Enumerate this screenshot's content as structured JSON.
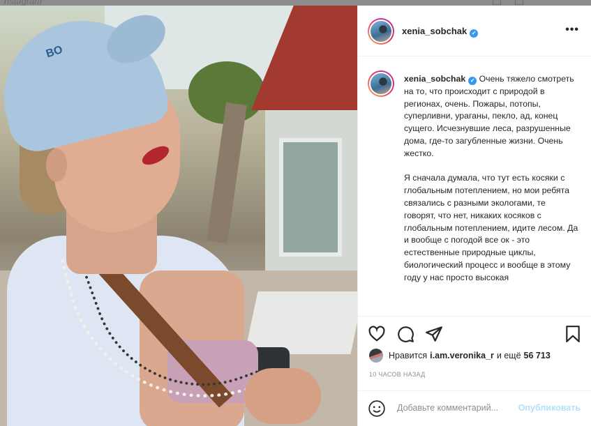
{
  "topbar": {
    "wordmark": "nstagram"
  },
  "photo": {
    "cap_text": "BO"
  },
  "post": {
    "username": "xenia_sobchak",
    "verified_mark": "✓",
    "more_label": "•••",
    "caption": {
      "username": "xenia_sobchak",
      "paragraphs": [
        "Очень тяжело смотреть на то, что происходит с природой в регионах, очень. Пожары, потопы, суперливни, ураганы, пекло, ад, конец сущего. Исчезнувшие леса, разрушенные дома, где-то загубленные жизни. Очень жестко.",
        "Я сначала думала, что тут есть косяки с глобальным потеплением, но мои ребята связались с разными экологами, те говорят, что нет, никаких косяков с глобальным потеплением, идите лесом. Да и вообще с погодой все ок - это естественные природные циклы, биологический процесс и вообще в этому году у нас просто высокая"
      ]
    },
    "likes": {
      "prefix": "Нравится",
      "user": "i.am.veronika_r",
      "middle": "и ещё",
      "count": "56 713"
    },
    "timestamp": "10 ЧАСОВ НАЗАД",
    "comment": {
      "placeholder": "Добавьте комментарий...",
      "publish_label": "Опубликовать"
    }
  },
  "icons": [
    "heart-icon",
    "comment-icon",
    "share-icon",
    "bookmark-icon",
    "emoji-icon",
    "more-icon",
    "verified-icon"
  ],
  "colors": {
    "verified": "#3897f0",
    "publish": "#b2dffc",
    "text": "#262626",
    "muted": "#8e8e8e"
  }
}
